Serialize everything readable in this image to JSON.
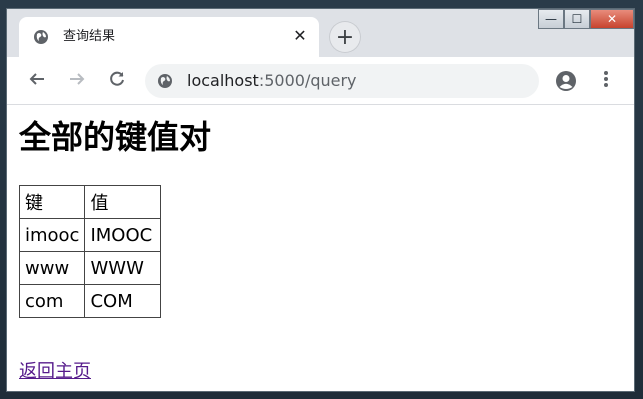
{
  "window": {
    "caption_buttons": {
      "minimize": "—",
      "maximize": "☐",
      "close": "✕"
    }
  },
  "tab": {
    "title": "查询结果",
    "favicon": "globe-icon",
    "close_glyph": "✕"
  },
  "new_tab": {
    "glyph": "+"
  },
  "toolbar": {
    "back_icon": "arrow-left-icon",
    "forward_icon": "arrow-right-icon",
    "reload_icon": "reload-icon",
    "profile_icon": "account-icon",
    "menu_icon": "kebab-menu-icon"
  },
  "address_bar": {
    "host": "localhost",
    "path": ":5000/query",
    "site_icon": "globe-icon"
  },
  "page": {
    "heading": "全部的键值对",
    "table": {
      "headers": [
        "键",
        "值"
      ],
      "rows": [
        [
          "imooc",
          "IMOOC"
        ],
        [
          "www",
          "WWW"
        ],
        [
          "com",
          "COM"
        ]
      ]
    },
    "link_home": "返回主页"
  },
  "colors": {
    "tabstrip": "#dee1e6",
    "omnibox": "#f1f3f4",
    "visited_link": "#551a8b"
  }
}
